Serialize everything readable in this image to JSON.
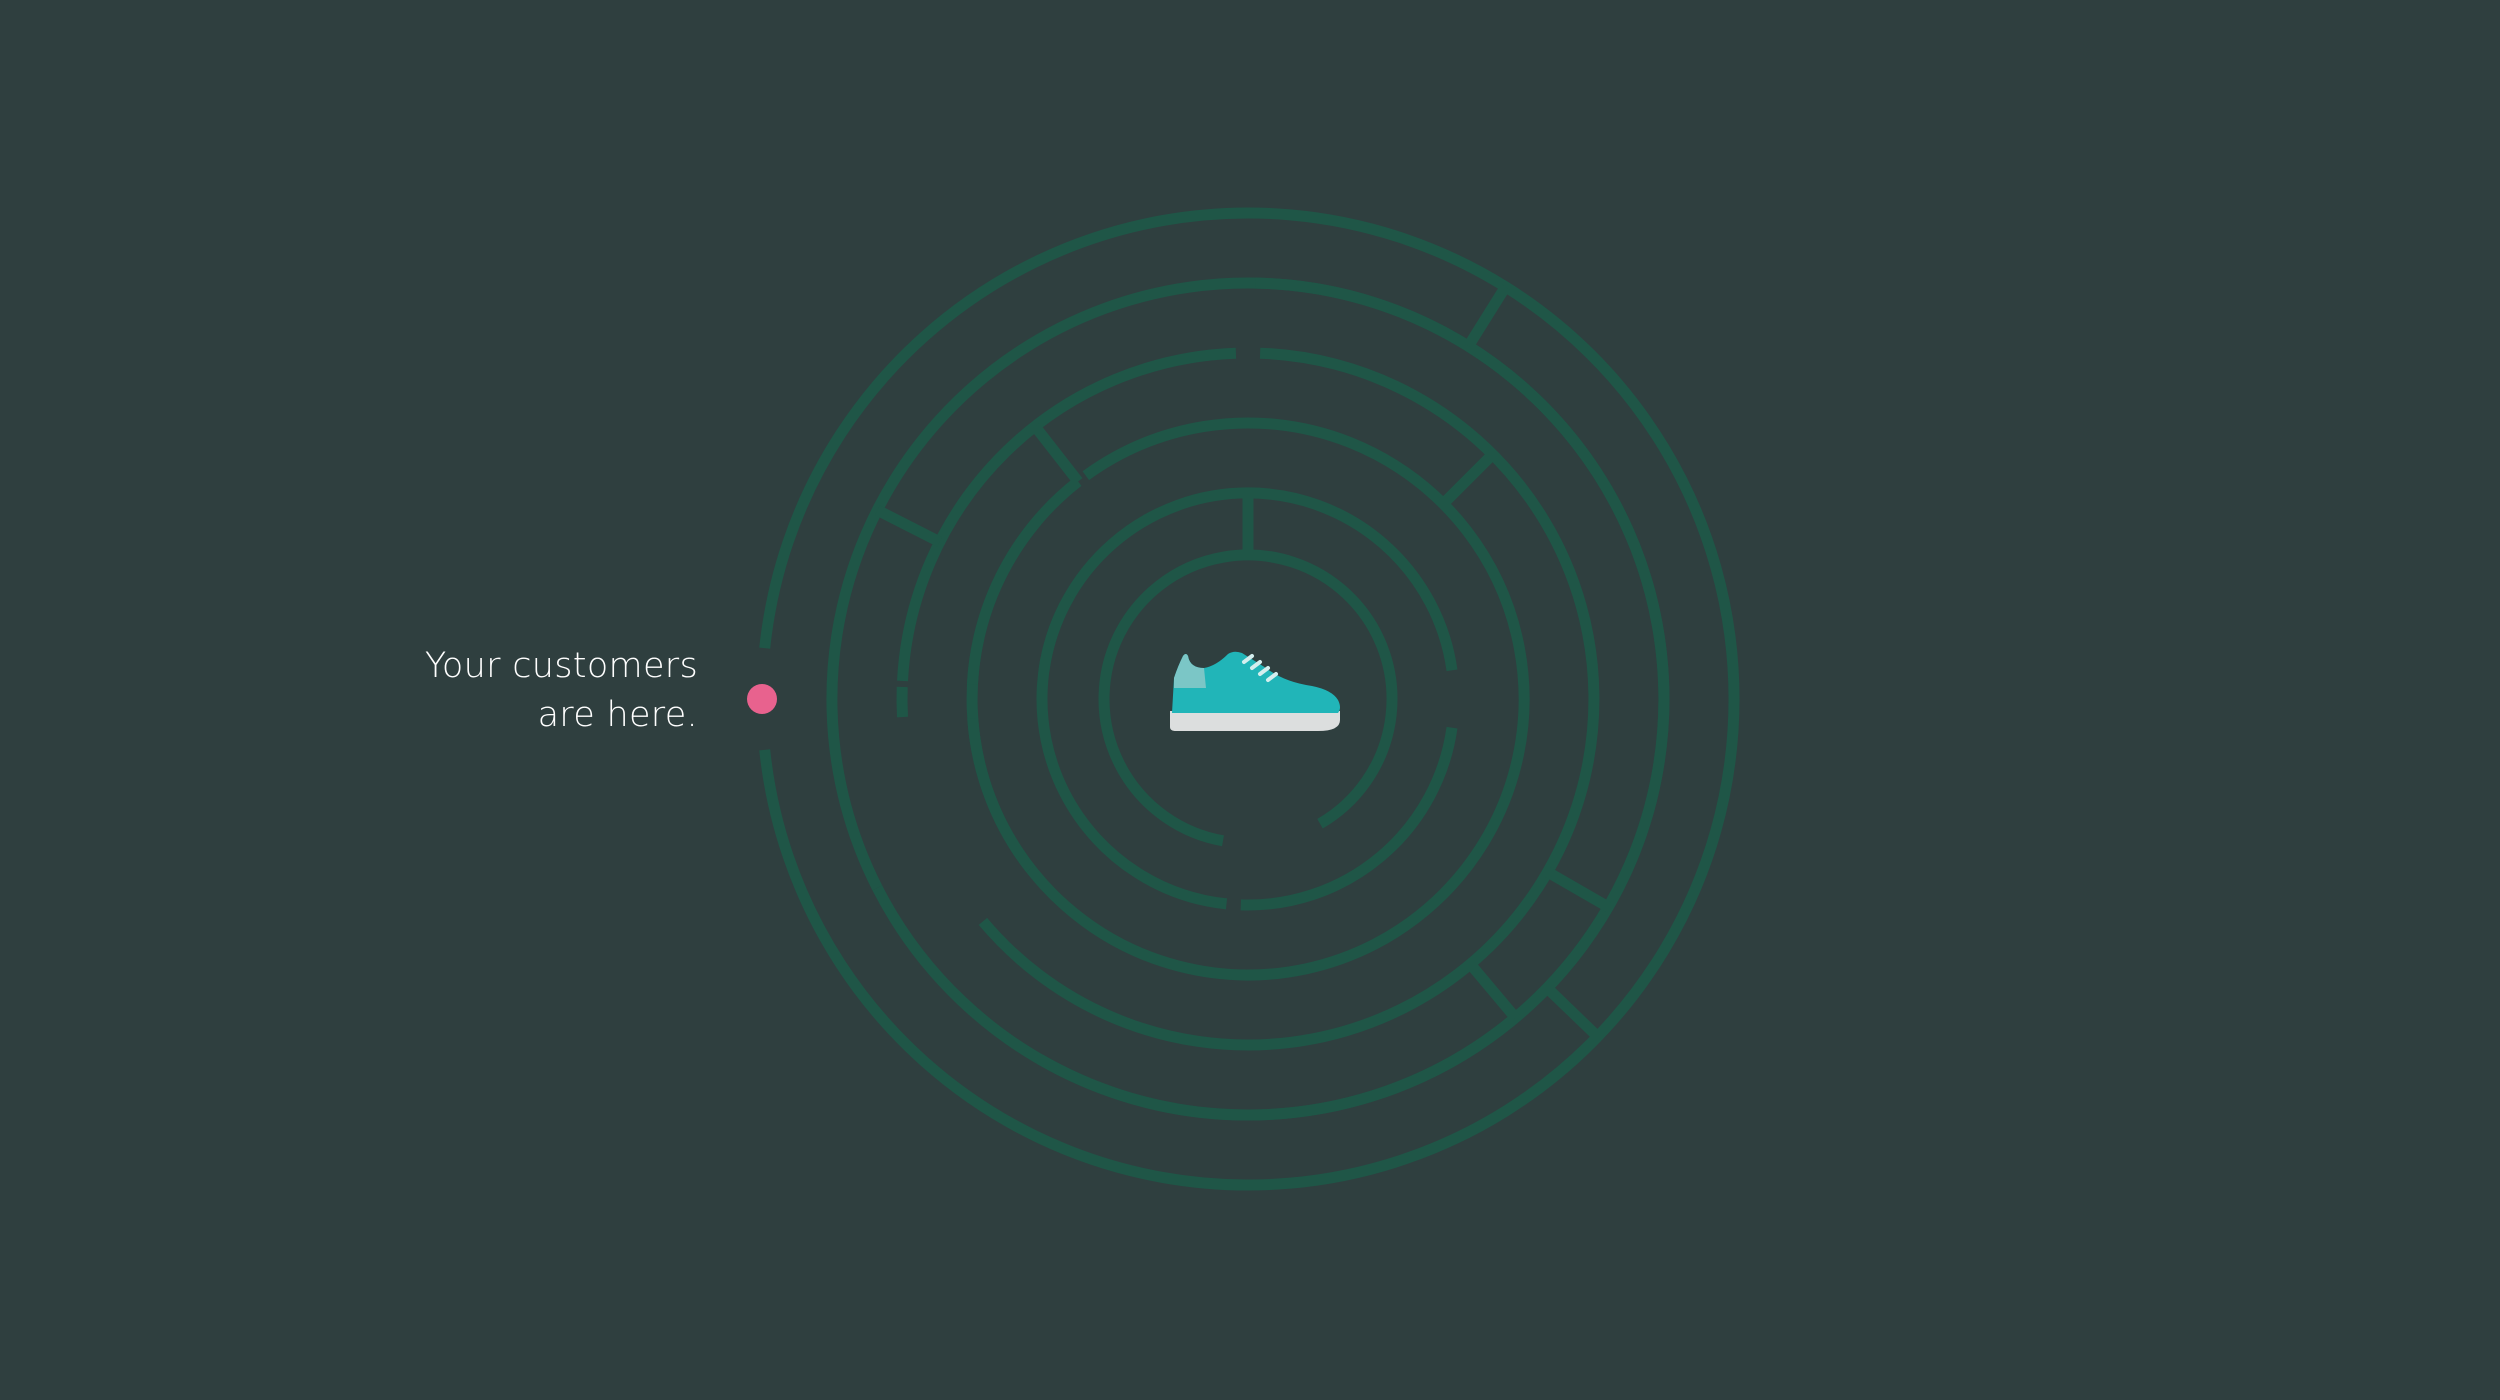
{
  "colors": {
    "background": "#2f3f3f",
    "maze_wall": "#1f5647",
    "marker": "#e8628e",
    "shoe_upper": "#21b5b8",
    "shoe_heel": "#7bc6c6",
    "shoe_sole": "#dcdede",
    "shoe_laces": "#d4eeee"
  },
  "caption": {
    "line1": "Your customers",
    "line2": "are here."
  },
  "icons": {
    "start_marker": "pink-dot",
    "goal": "sneaker-icon"
  }
}
